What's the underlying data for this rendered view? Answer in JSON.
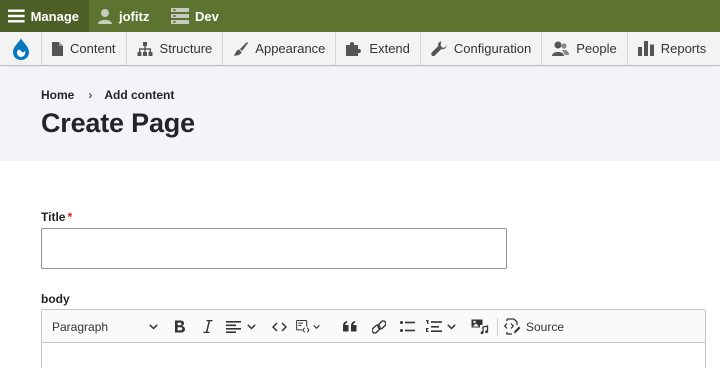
{
  "toolbar": {
    "manage_label": "Manage",
    "user_label": "jofitz",
    "env_label": "Dev"
  },
  "tray": {
    "items": [
      {
        "label": "Content",
        "icon": "file-icon"
      },
      {
        "label": "Structure",
        "icon": "sitemap-icon"
      },
      {
        "label": "Appearance",
        "icon": "paintbrush-icon"
      },
      {
        "label": "Extend",
        "icon": "puzzle-icon"
      },
      {
        "label": "Configuration",
        "icon": "wrench-icon"
      },
      {
        "label": "People",
        "icon": "people-icon"
      },
      {
        "label": "Reports",
        "icon": "bar-chart-icon"
      }
    ]
  },
  "breadcrumb": {
    "home": "Home",
    "separator": "›",
    "current": "Add content"
  },
  "page": {
    "title": "Create Page"
  },
  "form": {
    "title_label": "Title",
    "required_marker": "*",
    "title_value": "",
    "body_label": "body"
  },
  "editor": {
    "paragraph_label": "Paragraph",
    "source_label": "Source",
    "buttons": [
      "bold",
      "italic",
      "text-alignment",
      "code",
      "code-block",
      "block-quote",
      "link",
      "bulleted-list",
      "numbered-list",
      "insert-media",
      "source-editing"
    ]
  },
  "colors": {
    "toolbar_bg": "#5d7431",
    "manage_bg": "#4b5f26",
    "header_bg": "#f3f4f9",
    "required": "#dc2323"
  }
}
